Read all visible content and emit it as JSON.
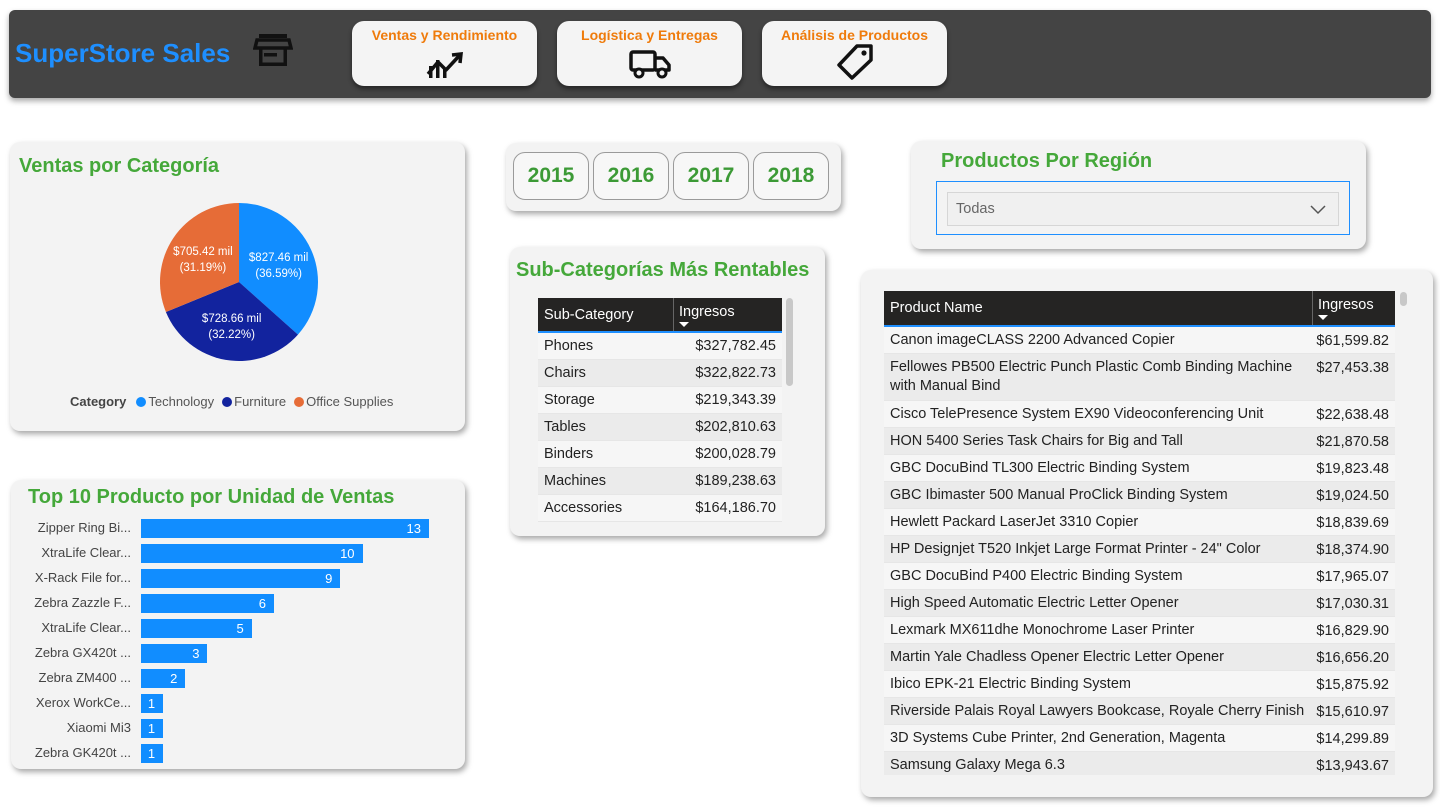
{
  "header": {
    "brand": "SuperStore Sales",
    "nav": [
      {
        "label": "Ventas y Rendimiento",
        "icon": "trend-chart-icon"
      },
      {
        "label": "Logística y Entregas",
        "icon": "truck-icon"
      },
      {
        "label": "Análisis de Productos",
        "icon": "price-tag-icon"
      }
    ]
  },
  "colors": {
    "accent_blue": "#1e8fff",
    "title_green": "#45a83a",
    "nav_orange": "#ef7b0b",
    "tech": "#118dff",
    "furniture": "#12239e",
    "office": "#e66c37"
  },
  "category_chart": {
    "title": "Ventas por Categoría",
    "legend_title": "Category"
  },
  "years": {
    "items": [
      "2015",
      "2016",
      "2017",
      "2018"
    ]
  },
  "region": {
    "title": "Productos Por Región",
    "selected": "Todas"
  },
  "subcat": {
    "title": "Sub-Categorías Más Rentables",
    "headers": [
      "Sub-Category",
      "Ingresos"
    ],
    "rows": [
      [
        "Phones",
        "$327,782.45"
      ],
      [
        "Chairs",
        "$322,822.73"
      ],
      [
        "Storage",
        "$219,343.39"
      ],
      [
        "Tables",
        "$202,810.63"
      ],
      [
        "Binders",
        "$200,028.79"
      ],
      [
        "Machines",
        "$189,238.63"
      ],
      [
        "Accessories",
        "$164,186.70"
      ]
    ]
  },
  "products": {
    "headers": [
      "Product Name",
      "Ingresos"
    ],
    "rows": [
      [
        "Canon imageCLASS 2200 Advanced Copier",
        "$61,599.82"
      ],
      [
        "Fellowes PB500 Electric Punch Plastic Comb Binding Machine with Manual Bind",
        "$27,453.38"
      ],
      [
        "Cisco TelePresence System EX90 Videoconferencing Unit",
        "$22,638.48"
      ],
      [
        "HON 5400 Series Task Chairs for Big and Tall",
        "$21,870.58"
      ],
      [
        "GBC DocuBind TL300 Electric Binding System",
        "$19,823.48"
      ],
      [
        "GBC Ibimaster 500 Manual ProClick Binding System",
        "$19,024.50"
      ],
      [
        "Hewlett Packard LaserJet 3310 Copier",
        "$18,839.69"
      ],
      [
        "HP Designjet T520 Inkjet Large Format Printer - 24\" Color",
        "$18,374.90"
      ],
      [
        "GBC DocuBind P400 Electric Binding System",
        "$17,965.07"
      ],
      [
        "High Speed Automatic Electric Letter Opener",
        "$17,030.31"
      ],
      [
        "Lexmark MX611dhe Monochrome Laser Printer",
        "$16,829.90"
      ],
      [
        "Martin Yale Chadless Opener Electric Letter Opener",
        "$16,656.20"
      ],
      [
        "Ibico EPK-21 Electric Binding System",
        "$15,875.92"
      ],
      [
        "Riverside Palais Royal Lawyers Bookcase, Royale Cherry Finish",
        "$15,610.97"
      ],
      [
        "3D Systems Cube Printer, 2nd Generation, Magenta",
        "$14,299.89"
      ],
      [
        "Samsung Galaxy Mega 6.3",
        "$13,943.67"
      ]
    ]
  },
  "top10": {
    "title": "Top 10 Producto por Unidad de Ventas"
  },
  "chart_data": [
    {
      "type": "pie",
      "title": "Ventas por Categoría",
      "legend_title": "Category",
      "legend_position": "bottom",
      "slices": [
        {
          "name": "Technology",
          "value": 827.46,
          "label": "$827.46 mil",
          "pct": "(36.59%)",
          "color": "#118dff"
        },
        {
          "name": "Furniture",
          "value": 728.66,
          "label": "$728.66 mil",
          "pct": "(32.22%)",
          "color": "#12239e"
        },
        {
          "name": "Office Supplies",
          "value": 705.42,
          "label": "$705.42 mil",
          "pct": "(31.19%)",
          "color": "#e66c37"
        }
      ]
    },
    {
      "type": "bar",
      "orientation": "horizontal",
      "title": "Top 10 Producto por Unidad de Ventas",
      "categories": [
        "Zipper Ring Bi...",
        "XtraLife Clear...",
        "X-Rack File for...",
        "Zebra Zazzle F...",
        "XtraLife Clear...",
        "Zebra GX420t ...",
        "Zebra ZM400 ...",
        "Xerox WorkCe...",
        "Xiaomi Mi3",
        "Zebra GK420t ..."
      ],
      "values": [
        13,
        10,
        9,
        6,
        5,
        3,
        2,
        1,
        1,
        1
      ],
      "xlim": [
        0,
        13
      ],
      "grid": false
    }
  ]
}
